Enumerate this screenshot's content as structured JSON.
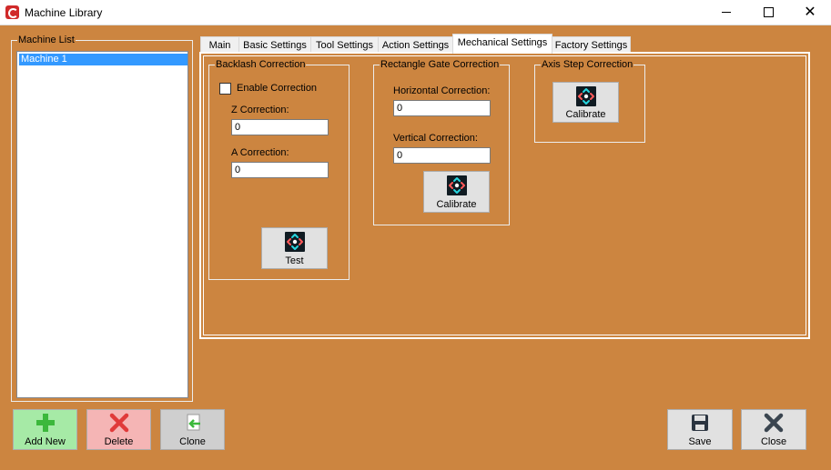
{
  "window": {
    "title": "Machine Library",
    "minimize_glyph": "",
    "maximize_glyph": "",
    "close_glyph": "✕"
  },
  "machine_list": {
    "legend": "Machine List",
    "items": [
      "Machine 1"
    ],
    "selected_index": 0
  },
  "tabs": [
    {
      "label": "Main"
    },
    {
      "label": "Basic Settings"
    },
    {
      "label": "Tool Settings"
    },
    {
      "label": "Action Settings"
    },
    {
      "label": "Mechanical Settings",
      "active": true
    },
    {
      "label": "Factory Settings"
    }
  ],
  "backlash": {
    "legend": "Backlash Correction",
    "enable_label": "Enable Correction",
    "enable_checked": false,
    "z_label": "Z Correction:",
    "z_value": "0",
    "a_label": "A Correction:",
    "a_value": "0",
    "test_label": "Test"
  },
  "rect_gate": {
    "legend": "Rectangle Gate Correction",
    "h_label": "Horizontal Correction:",
    "h_value": "0",
    "v_label": "Vertical Correction:",
    "v_value": "0",
    "calibrate_label": "Calibrate"
  },
  "axis_step": {
    "legend": "Axis Step Correction",
    "calibrate_label": "Calibrate"
  },
  "actions": {
    "add_new": "Add New",
    "delete": "Delete",
    "clone": "Clone",
    "save": "Save",
    "close": "Close"
  },
  "colors": {
    "background": "#cc8540",
    "add_new_bg": "#a6eaa6",
    "delete_bg": "#f5b5b5",
    "clone_bg": "#cfcfcf",
    "selection": "#3399ff"
  },
  "icons": {
    "app": "app-logo-icon",
    "calibrate": "calibrate-arrows-icon",
    "add": "plus-icon",
    "delete": "x-icon",
    "clone": "clone-document-icon",
    "save": "floppy-disk-icon",
    "close": "close-x-icon"
  }
}
